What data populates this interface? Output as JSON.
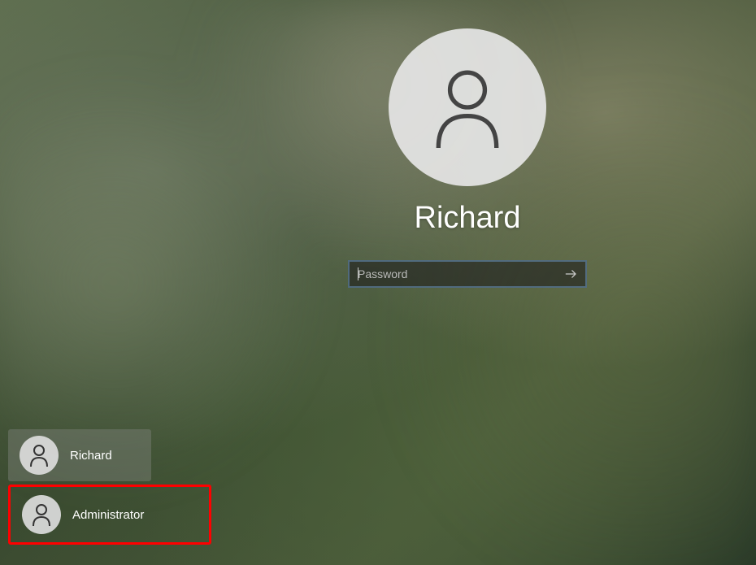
{
  "current_user": {
    "name": "Richard"
  },
  "password_field": {
    "placeholder": "Password",
    "value": ""
  },
  "user_list": [
    {
      "name": "Richard",
      "selected": true,
      "highlighted": false
    },
    {
      "name": "Administrator",
      "selected": false,
      "highlighted": true
    }
  ],
  "colors": {
    "highlight_border": "#ff0000",
    "input_border": "#4a7ab0"
  }
}
